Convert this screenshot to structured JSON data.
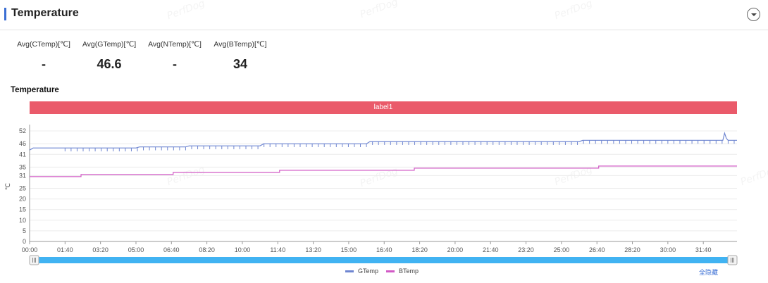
{
  "header": {
    "title": "Temperature"
  },
  "watermark_text": "PerfDog",
  "stats": [
    {
      "label": "Avg(CTemp)[℃]",
      "value": "-"
    },
    {
      "label": "Avg(GTemp)[℃]",
      "value": "46.6"
    },
    {
      "label": "Avg(NTemp)[℃]",
      "value": "-"
    },
    {
      "label": "Avg(BTemp)[℃]",
      "value": "34"
    }
  ],
  "chart": {
    "title": "Temperature",
    "label_band": "label1",
    "show_all_label": "全隐藏"
  },
  "colors": {
    "accent": "#3b6fd4",
    "label_band": "#ea5a6a",
    "scrollbar": "#41b3f2"
  },
  "chart_data": {
    "type": "line",
    "title": "Temperature",
    "xlabel": "",
    "ylabel": "℃",
    "ylim": [
      0,
      55
    ],
    "yticks": [
      "0",
      "5",
      "10",
      "15",
      "20",
      "25",
      "31",
      "35",
      "41",
      "46",
      "52"
    ],
    "xticks": [
      "00:00",
      "01:40",
      "03:20",
      "05:00",
      "06:40",
      "08:20",
      "10:00",
      "11:40",
      "13:20",
      "15:00",
      "16:40",
      "18:20",
      "20:00",
      "21:40",
      "23:20",
      "25:00",
      "26:40",
      "28:20",
      "30:00",
      "31:40"
    ],
    "x_range_seconds": [
      0,
      1995
    ],
    "grid": true,
    "legend_position": "bottom",
    "series": [
      {
        "name": "GTemp",
        "color": "#6f86d1",
        "points": [
          [
            0,
            43
          ],
          [
            10,
            44
          ],
          [
            300,
            44
          ],
          [
            310,
            44.5
          ],
          [
            440,
            44.5
          ],
          [
            450,
            45
          ],
          [
            650,
            45
          ],
          [
            660,
            46
          ],
          [
            950,
            46
          ],
          [
            960,
            47
          ],
          [
            1550,
            47
          ],
          [
            1560,
            47.6
          ],
          [
            1955,
            47.6
          ],
          [
            1960,
            51
          ],
          [
            1965,
            48.5
          ],
          [
            1970,
            47.6
          ],
          [
            1995,
            47.6
          ]
        ]
      },
      {
        "name": "BTemp",
        "color": "#d25ac6",
        "points": [
          [
            0,
            30.5
          ],
          [
            145,
            30.5
          ],
          [
            145,
            31.5
          ],
          [
            405,
            31.5
          ],
          [
            405,
            32.5
          ],
          [
            705,
            32.5
          ],
          [
            705,
            33.5
          ],
          [
            1085,
            33.5
          ],
          [
            1085,
            34.5
          ],
          [
            1605,
            34.5
          ],
          [
            1605,
            35.5
          ],
          [
            1995,
            35.5
          ]
        ]
      }
    ]
  }
}
